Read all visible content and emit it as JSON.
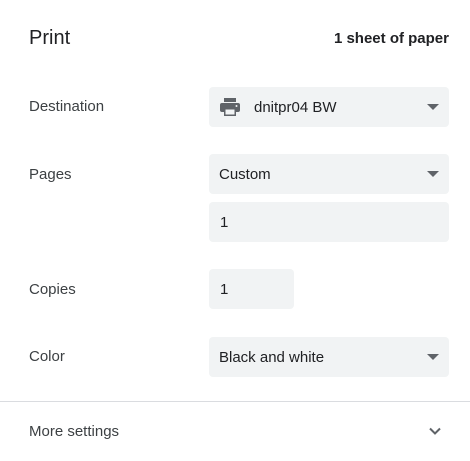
{
  "header": {
    "title": "Print",
    "sheet_count": "1 sheet of paper"
  },
  "destination": {
    "label": "Destination",
    "value": "dnitpr04 BW",
    "icon": "printer-icon"
  },
  "pages": {
    "label": "Pages",
    "value": "Custom",
    "custom_range": "1"
  },
  "copies": {
    "label": "Copies",
    "value": "1"
  },
  "color": {
    "label": "Color",
    "value": "Black and white"
  },
  "more_settings": {
    "label": "More settings",
    "icon": "chevron-down-icon"
  },
  "colors": {
    "field_bg": "#f1f3f4",
    "text": "#202124",
    "icon": "#5f6368",
    "divider": "#dadce0"
  }
}
